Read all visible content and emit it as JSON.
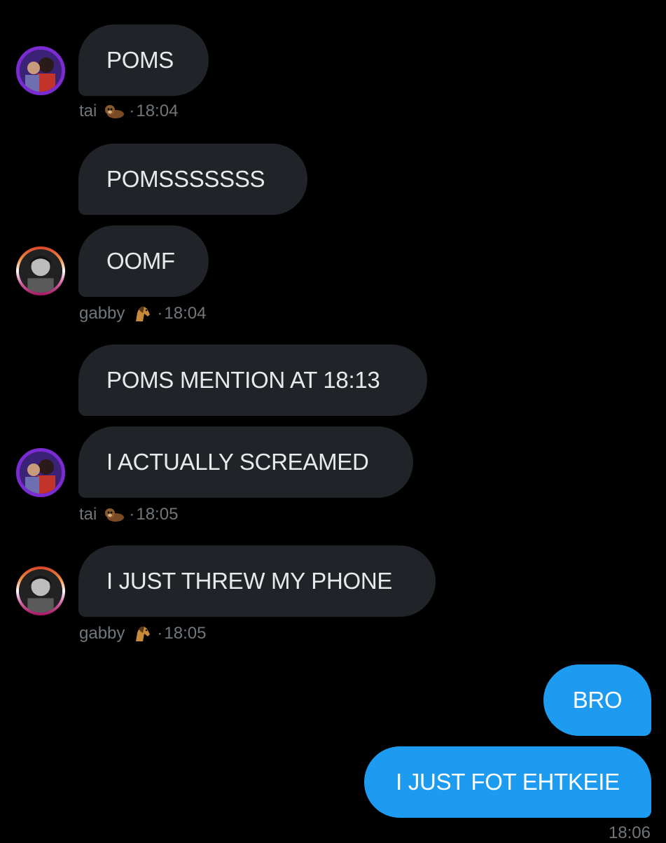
{
  "colors": {
    "background": "#000000",
    "incoming_bubble": "#202327",
    "outgoing_bubble": "#1d9bf0",
    "meta_text": "#71767b"
  },
  "conversation": {
    "messages": [
      {
        "text": "POMS"
      },
      {
        "text": "POMSSSSSSS"
      },
      {
        "text": "OOMF"
      },
      {
        "text": "POMS MENTION AT 18:13"
      },
      {
        "text": "I ACTUALLY SCREAMED"
      },
      {
        "text": "I JUST THREW MY PHONE"
      },
      {
        "text": "BRO"
      },
      {
        "text": "I JUST FOT EHTKEIE"
      }
    ],
    "meta": [
      {
        "sender": "tai",
        "emoji": "otter-emoji",
        "separator": "·",
        "time": "18:04"
      },
      {
        "sender": "gabby",
        "emoji": "horse-emoji",
        "separator": "·",
        "time": "18:04"
      },
      {
        "sender": "tai",
        "emoji": "otter-emoji",
        "separator": "·",
        "time": "18:05"
      },
      {
        "sender": "gabby",
        "emoji": "horse-emoji",
        "separator": "·",
        "time": "18:05"
      }
    ],
    "outgoing_time": "18:06"
  }
}
